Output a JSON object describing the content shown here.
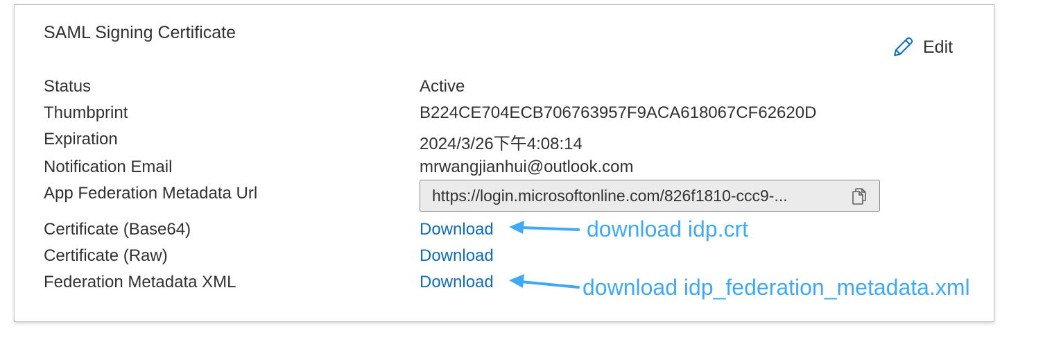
{
  "card": {
    "title": "SAML Signing Certificate",
    "edit_label": "Edit"
  },
  "fields": {
    "status": {
      "label": "Status",
      "value": "Active"
    },
    "thumbprint": {
      "label": "Thumbprint",
      "value": "B224CE704ECB706763957F9ACA618067CF62620D"
    },
    "expiration": {
      "label": "Expiration",
      "value": "2024/3/26下午4:08:14"
    },
    "notification_email": {
      "label": "Notification Email",
      "value": "mrwangjianhui@outlook.com"
    },
    "metadata_url": {
      "label": "App Federation Metadata Url",
      "value": "https://login.microsoftonline.com/826f1810-ccc9-..."
    },
    "cert_base64": {
      "label": "Certificate (Base64)",
      "link": "Download"
    },
    "cert_raw": {
      "label": "Certificate (Raw)",
      "link": "Download"
    },
    "federation_xml": {
      "label": "Federation Metadata XML",
      "link": "Download"
    }
  },
  "annotations": {
    "base64_note": "download idp.crt",
    "xml_note": "download idp_federation_metadata.xml"
  },
  "colors": {
    "link": "#0f6cbd",
    "annotation": "#3fa9f5",
    "text": "#323130",
    "url_box_bg": "#ebebeb"
  },
  "icons": {
    "edit": "pencil-icon",
    "copy": "copy-icon",
    "arrow": "arrow-left-icon"
  }
}
